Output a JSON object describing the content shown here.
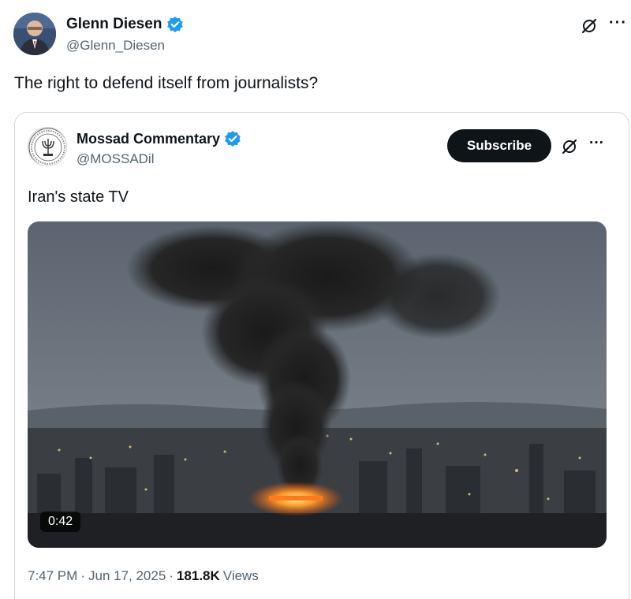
{
  "post": {
    "author_name": "Glenn Diesen",
    "author_handle": "@Glenn_Diesen",
    "text": "The right to defend itself from journalists?",
    "icons": {
      "verified": "verified-badge-icon",
      "grok": "grok-icon",
      "more": "more-icon"
    }
  },
  "quote": {
    "author_name": "Mossad Commentary",
    "author_handle": "@MOSSADil",
    "subscribe_label": "Subscribe",
    "text": "Iran's state TV",
    "video_duration": "0:42",
    "time": "7:47 PM",
    "separator": "·",
    "date": "Jun 17, 2025",
    "views_count": "181.8K",
    "views_label": "Views"
  },
  "colors": {
    "verified_blue": "#1d9bf0",
    "text_primary": "#0f1419",
    "text_secondary": "#536471",
    "border": "#cfd9de",
    "button_bg": "#0f1419"
  }
}
